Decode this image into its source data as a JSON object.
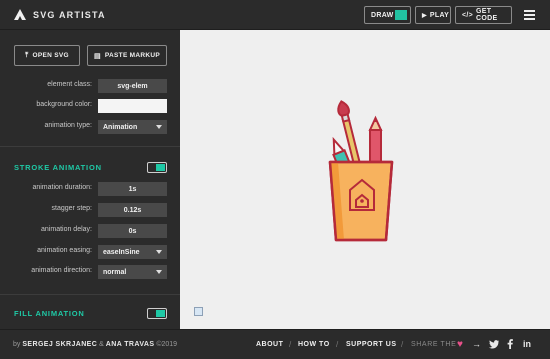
{
  "app": {
    "title": "SVG ARTISTA"
  },
  "toolbar": {
    "draw_label": "DRAW",
    "draw_swatch_color": "#22c3a3",
    "play_label": "PLAY",
    "code_label": "GET CODE"
  },
  "sidebar": {
    "open_svg_label": "OPEN SVG",
    "paste_markup_label": "PASTE MARKUP",
    "element_class": {
      "label": "element class:",
      "value": "svg-elem"
    },
    "background_color": {
      "label": "background color:",
      "value": "#f4f4f4"
    },
    "animation_type": {
      "label": "animation type:",
      "value": "Animation"
    },
    "stroke_section": {
      "title": "STROKE ANIMATION",
      "enabled": true
    },
    "animation_duration": {
      "label": "animation duration:",
      "value": "1s"
    },
    "stagger_step": {
      "label": "stagger step:",
      "value": "0.12s"
    },
    "animation_delay": {
      "label": "animation delay:",
      "value": "0s"
    },
    "animation_easing": {
      "label": "animation easing:",
      "value": "easeInSine"
    },
    "animation_direction": {
      "label": "animation direction:",
      "value": "normal"
    },
    "fill_section": {
      "title": "FILL ANIMATION",
      "enabled": true
    }
  },
  "footer": {
    "by": "by",
    "author1": "SERGEJ SKRJANEC",
    "amp": "&",
    "author2": "ANA TRAVAS",
    "copyright": "©2019",
    "about": "ABOUT",
    "howto": "HOW TO",
    "support": "SUPPORT US",
    "share_label": "SHARE THE",
    "arrow": "→",
    "twitter_icon": "twitter-icon",
    "facebook_icon": "facebook-icon",
    "linkedin_icon": "linkedin-icon"
  },
  "colors": {
    "accent": "#1fc9a6",
    "heart": "#e8508a"
  }
}
